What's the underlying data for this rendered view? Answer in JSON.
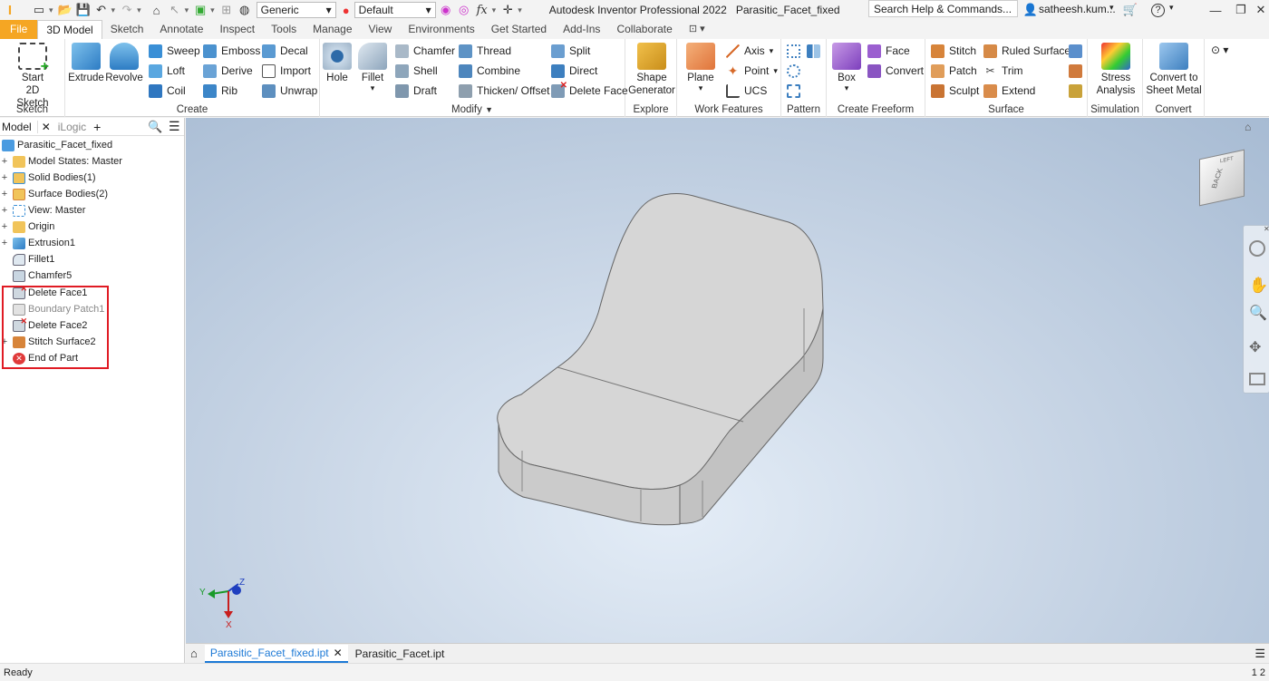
{
  "qat": {
    "appearance": "Generic",
    "material": "Default",
    "fx": "fx"
  },
  "title": {
    "app": "Autodesk Inventor Professional 2022",
    "document": "Parasitic_Facet_fixed"
  },
  "search": {
    "placeholder": "Search Help & Commands..."
  },
  "user": {
    "name": "satheesh.kum..."
  },
  "tabs": [
    "File",
    "3D Model",
    "Sketch",
    "Annotate",
    "Inspect",
    "Tools",
    "Manage",
    "View",
    "Environments",
    "Get Started",
    "Add-Ins",
    "Collaborate"
  ],
  "ribbon": {
    "sketch": {
      "title": "Sketch",
      "start": "Start",
      "start2": "2D Sketch"
    },
    "create": {
      "title": "Create",
      "extrude": "Extrude",
      "revolve": "Revolve",
      "sweep": "Sweep",
      "loft": "Loft",
      "coil": "Coil",
      "emboss": "Emboss",
      "derive": "Derive",
      "rib": "Rib",
      "decal": "Decal",
      "import": "Import",
      "unwrap": "Unwrap"
    },
    "modify": {
      "title": "Modify",
      "hole": "Hole",
      "fillet": "Fillet",
      "chamfer": "Chamfer",
      "shell": "Shell",
      "draft": "Draft",
      "thread": "Thread",
      "combine": "Combine",
      "thicken": "Thicken/ Offset",
      "split": "Split",
      "direct": "Direct",
      "deleteface": "Delete Face"
    },
    "explore": {
      "title": "Explore",
      "shape1": "Shape",
      "shape2": "Generator"
    },
    "work": {
      "title": "Work Features",
      "plane": "Plane",
      "axis": "Axis",
      "point": "Point",
      "ucs": "UCS"
    },
    "pattern": {
      "title": "Pattern"
    },
    "freeform": {
      "title": "Create Freeform",
      "box": "Box",
      "face": "Face",
      "convert": "Convert"
    },
    "surface": {
      "title": "Surface",
      "stitch": "Stitch",
      "patch": "Patch",
      "sculpt": "Sculpt",
      "ruled": "Ruled Surface",
      "trim": "Trim",
      "extend": "Extend"
    },
    "simulation": {
      "title": "Simulation",
      "stress1": "Stress",
      "stress2": "Analysis"
    },
    "convert": {
      "title": "Convert",
      "c1": "Convert to",
      "c2": "Sheet Metal"
    }
  },
  "browser": {
    "tab_model": "Model",
    "tab_ilogic": "iLogic",
    "root": "Parasitic_Facet_fixed",
    "nodes": [
      "Model States: Master",
      "Solid Bodies(1)",
      "Surface Bodies(2)",
      "View: Master",
      "Origin",
      "Extrusion1",
      "Fillet1",
      "Chamfer5",
      "Delete Face1",
      "Boundary Patch1",
      "Delete Face2",
      "Stitch Surface2",
      "End of Part"
    ]
  },
  "viewcube": {
    "back": "BACK",
    "left": "LEFT"
  },
  "triad": {
    "x": "X",
    "y": "Y",
    "z": "Z"
  },
  "doctabs": [
    "Parasitic_Facet_fixed.ipt",
    "Parasitic_Facet.ipt"
  ],
  "status": {
    "left": "Ready",
    "right": "1 2"
  }
}
